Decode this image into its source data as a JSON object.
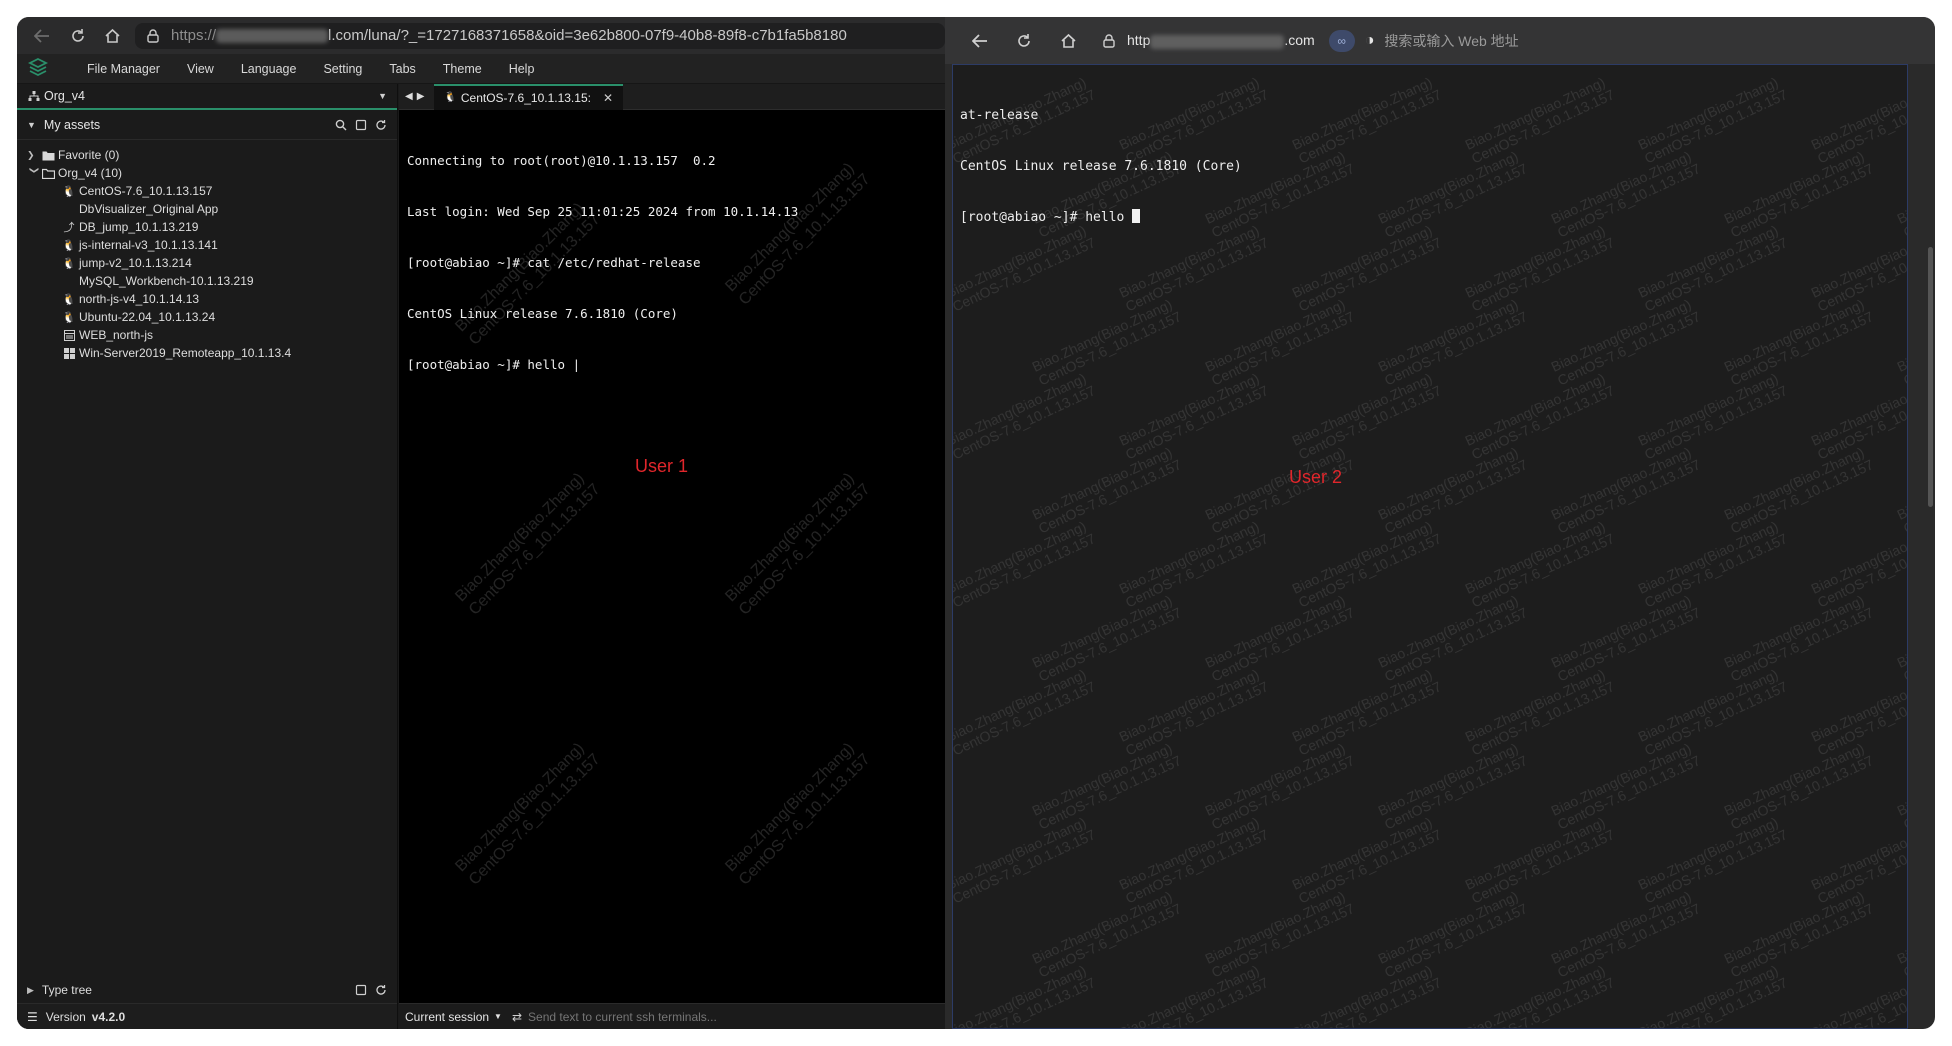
{
  "left_window": {
    "url_prefix": "https://",
    "url_suffix": "l.com/luna/?_=1727168371658&oid=3e62b800-07f9-40b8-89f8-c7b1fa5b8180",
    "menu": [
      "File Manager",
      "View",
      "Language",
      "Setting",
      "Tabs",
      "Theme",
      "Help"
    ],
    "org_selector": "Org_v4",
    "assets_title": "My assets",
    "tree": {
      "favorite": "Favorite (0)",
      "org": "Org_v4 (10)",
      "assets": [
        {
          "label": "CentOS-7.6_10.1.13.157",
          "icon": "linux-icon"
        },
        {
          "label": "DbVisualizer_Original App",
          "icon": "none"
        },
        {
          "label": "DB_jump_10.1.13.219",
          "icon": "link-icon"
        },
        {
          "label": "js-internal-v3_10.1.13.141",
          "icon": "linux-icon"
        },
        {
          "label": "jump-v2_10.1.13.214",
          "icon": "linux-icon"
        },
        {
          "label": "MySQL_Workbench-10.1.13.219",
          "icon": "none"
        },
        {
          "label": "north-js-v4_10.1.14.13",
          "icon": "linux-icon"
        },
        {
          "label": "Ubuntu-22.04_10.1.13.24",
          "icon": "linux-icon"
        },
        {
          "label": "WEB_north-js",
          "icon": "web-icon"
        },
        {
          "label": "Win-Server2019_Remoteapp_10.1.13.4",
          "icon": "windows-icon"
        }
      ]
    },
    "type_tree": "Type tree",
    "version_label": "Version",
    "version_value": "v4.2.0",
    "tab_title": "CentOS-7.6_10.1.13.15:",
    "terminal_lines": [
      "Connecting to root(root)@10.1.13.157  0.2",
      "Last login: Wed Sep 25 11:01:25 2024 from 10.1.14.13",
      "[root@abiao ~]# cat /etc/redhat-release",
      "CentOS Linux release 7.6.1810 (Core)",
      "[root@abiao ~]# hello |"
    ],
    "session_select": "Current session",
    "send_placeholder": "Send text to current ssh terminals...",
    "user_label": "User 1",
    "watermark": "Biao.Zhang(Biao.Zhang)\nCentOS-7.6_10.1.13.157"
  },
  "right_window": {
    "url_prefix": "http",
    "url_suffix": ".com",
    "address_hint": "搜索或输入 Web 地址",
    "terminal_lines": [
      "at-release",
      "CentOS Linux release 7.6.1810 (Core)",
      "[root@abiao ~]# hello "
    ],
    "user_label": "User 2",
    "watermark": "Biao.Zhang(Biao.Zhang)\nCentOS-7.6_10.1.13.157"
  },
  "colors": {
    "accent_green": "#2a8f6a",
    "user_label_red": "#e0262b"
  }
}
